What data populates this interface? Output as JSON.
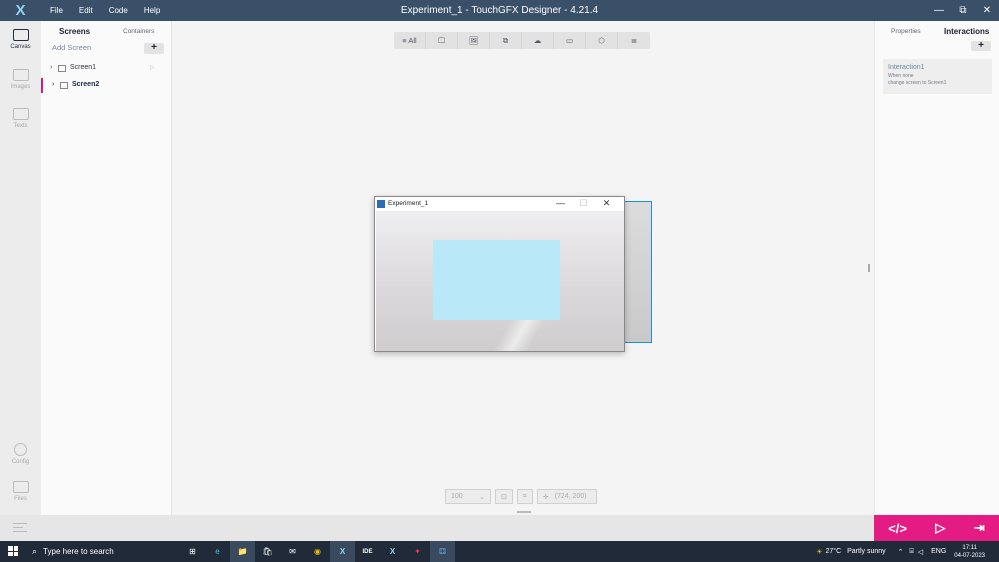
{
  "titlebar": {
    "logo": "X",
    "menu": [
      "File",
      "Edit",
      "Code",
      "Help"
    ],
    "title": "Experiment_1 - TouchGFX Designer - 4.21.4",
    "min": "—",
    "restore": "⧉",
    "close": "✕"
  },
  "rail": {
    "canvas": "Canvas",
    "images": "Images",
    "texts": "Texts",
    "config": "Config",
    "files": "Files"
  },
  "screens": {
    "tab_screens": "Screens",
    "tab_containers": "Containers",
    "add_screen": "Add Screen",
    "add_plus": "+",
    "items": [
      {
        "label": "Screen1"
      },
      {
        "label": "Screen2"
      }
    ]
  },
  "toolbar": {
    "all": "≡ All",
    "icons": [
      "🖵",
      "🖼",
      "⧉",
      "☁",
      "▭",
      "⬡",
      "≣"
    ]
  },
  "simulator": {
    "title": "Experiment_1",
    "min": "—",
    "max": "☐",
    "close": "✕"
  },
  "bottombar": {
    "zoom": "100",
    "zoom_arrow": "⌄",
    "fit_icon": "⊡",
    "crop_icon": "⌗",
    "coord_icon": "✛",
    "coord": "(724, 200)"
  },
  "right": {
    "tab_properties": "Properties",
    "tab_interactions": "Interactions",
    "add_plus": "+",
    "interaction": {
      "name": "Interaction1",
      "trigger": "When none",
      "action": "change screen to Screen1"
    }
  },
  "actions": {
    "code": "</>",
    "run": "▷",
    "export": "⇥"
  },
  "taskbar": {
    "search": "Type here to search",
    "weather_temp": "27°C",
    "weather_desc": "Partly sunny",
    "lang": "ENG",
    "time": "17:11",
    "date": "04-07-2023",
    "apps": [
      "⊞",
      "e",
      "📁",
      "🛍",
      "✉",
      "◉",
      "X",
      "IDE",
      "X",
      "✦",
      "⚃"
    ]
  },
  "colors": {
    "titlebar": "#3a5069",
    "accent": "#e31b83",
    "selection": "#1d8fe0",
    "rect": "#b9e8f8"
  }
}
